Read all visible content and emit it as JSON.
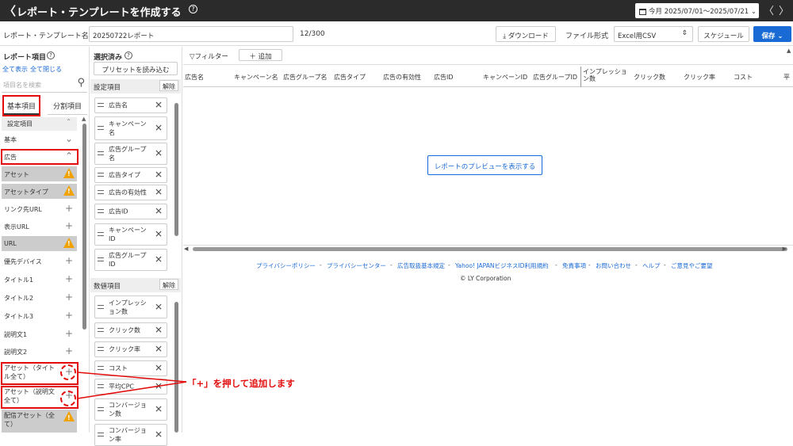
{
  "header": {
    "back": "〈",
    "title": "レポート・テンプレートを作成する",
    "help": "?",
    "date_range": "今月 2025/07/01〜2025/07/21",
    "prev": "〈",
    "next": "〉"
  },
  "toolbar": {
    "name_label": "レポート・テンプレート名",
    "name_value": "20250722レポート",
    "counter": "12/300",
    "download": "ダウンロード",
    "format_label": "ファイル形式",
    "format_value": "Excel用CSV",
    "schedule": "スケジュール",
    "save": "保存"
  },
  "left": {
    "title": "レポート項目",
    "help": "?",
    "show_all": "全て表示",
    "collapse_all": "全て閉じる",
    "search_placeholder": "項目名を検索",
    "tab_basic": "基本項目",
    "tab_split": "分割項目",
    "settings_header": "設定項目",
    "items": [
      {
        "label": "基本",
        "sym": "⌄",
        "gray": false
      },
      {
        "label": "広告",
        "sym": "⌃",
        "gray": false
      },
      {
        "label": "アセット",
        "sym": "warn",
        "gray": true
      },
      {
        "label": "アセットタイプ",
        "sym": "warn",
        "gray": true
      },
      {
        "label": "リンク先URL",
        "sym": "+",
        "gray": false
      },
      {
        "label": "表示URL",
        "sym": "+",
        "gray": false
      },
      {
        "label": "URL",
        "sym": "warn",
        "gray": true
      },
      {
        "label": "優先デバイス",
        "sym": "+",
        "gray": false
      },
      {
        "label": "タイトル1",
        "sym": "+",
        "gray": false
      },
      {
        "label": "タイトル2",
        "sym": "+",
        "gray": false
      },
      {
        "label": "タイトル3",
        "sym": "+",
        "gray": false
      },
      {
        "label": "説明文1",
        "sym": "+",
        "gray": false
      },
      {
        "label": "説明文2",
        "sym": "+",
        "gray": false
      },
      {
        "label": "アセット（タイトル全て）",
        "sym": "+",
        "gray": false
      },
      {
        "label": "アセット（説明文全て）",
        "sym": "+",
        "gray": false
      },
      {
        "label": "配信アセット（全て）",
        "sym": "warn",
        "gray": true
      }
    ]
  },
  "middle": {
    "title": "選択済み",
    "help": "?",
    "preset": "プリセットを読み込む",
    "settings_label": "設定項目",
    "clear": "解除",
    "settings_items": [
      "広告名",
      "キャンペーン名",
      "広告グループ名",
      "広告タイプ",
      "広告の有効性",
      "広告ID",
      "キャンペーンID",
      "広告グループID"
    ],
    "metrics_label": "数値項目",
    "metrics_items": [
      "インプレッション数",
      "クリック数",
      "クリック率",
      "コスト",
      "平均CPC",
      "コンバージョン数",
      "コンバージョン率"
    ]
  },
  "main": {
    "filter": "フィルター",
    "add": "追加",
    "columns": [
      "広告名",
      "キャンペーン名",
      "広告グループ名",
      "広告タイプ",
      "広告の有効性",
      "広告ID",
      "キャンペーンID",
      "広告グループID",
      "インプレッション数",
      "クリック数",
      "クリック率",
      "コスト",
      "平"
    ],
    "preview_button": "レポートのプレビューを表示する",
    "footer_links": [
      "プライバシーポリシー",
      "プライバシーセンター",
      "広告取扱基本規定",
      "Yahoo! JAPANビジネスID利用規約",
      "免責事項",
      "お問い合わせ",
      "ヘルプ",
      "ご意見やご要望"
    ],
    "copyright": "© LY Corporation"
  },
  "annotation": "「+」を押して追加します",
  "colors": {
    "accent": "#1a6ad6",
    "header_bg": "#2b2b2b",
    "annotation": "#e30b0b",
    "warning": "#f2a200"
  }
}
